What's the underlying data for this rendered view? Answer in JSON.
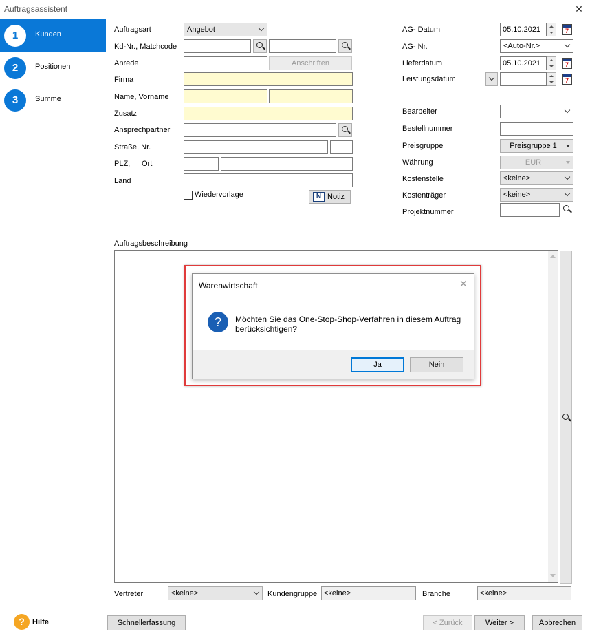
{
  "window": {
    "title": "Auftragsassistent",
    "close_glyph": "✕"
  },
  "sidebar": {
    "steps": [
      {
        "number": "1",
        "label": "Kunden",
        "active": true
      },
      {
        "number": "2",
        "label": "Positionen",
        "active": false
      },
      {
        "number": "3",
        "label": "Summe",
        "active": false
      }
    ]
  },
  "customer": {
    "auftragsart_label": "Auftragsart",
    "auftragsart_value": "Angebot",
    "kdnr_label": "Kd-Nr., Matchcode",
    "anrede_label": "Anrede",
    "anschriften_button": "Anschriften",
    "firma_label": "Firma",
    "name_label": "Name,  Vorname",
    "zusatz_label": "Zusatz",
    "ansprechpartner_label": "Ansprechpartner",
    "strasse_label": "Straße, Nr.",
    "plz_label": "PLZ,",
    "ort_label": "Ort",
    "land_label": "Land",
    "wiedervorlage_label": "Wiedervorlage",
    "notiz_button": "Notiz",
    "notiz_icon_letter": "N"
  },
  "order": {
    "ag_datum_label": "AG- Datum",
    "ag_datum_value": "05.10.2021",
    "ag_nr_label": "AG- Nr.",
    "ag_nr_value": "<Auto-Nr.>",
    "lieferdatum_label": "Lieferdatum",
    "lieferdatum_value": "05.10.2021",
    "leistungsdatum_label": "Leistungsdatum",
    "bearbeiter_label": "Bearbeiter",
    "bestellnummer_label": "Bestellnummer",
    "preisgruppe_label": "Preisgruppe",
    "preisgruppe_value": "Preisgruppe 1",
    "waehrung_label": "Währung",
    "waehrung_value": "EUR",
    "kostenstelle_label": "Kostenstelle",
    "kostenstelle_value": "<keine>",
    "kostentraeger_label": "Kostenträger",
    "kostentraeger_value": "<keine>",
    "projektnummer_label": "Projektnummer"
  },
  "description": {
    "label": "Auftragsbeschreibung"
  },
  "bottom": {
    "vertreter_label": "Vertreter",
    "vertreter_value": "<keine>",
    "kundengruppe_label": "Kundengruppe",
    "kundengruppe_value": "<keine>",
    "branche_label": "Branche",
    "branche_value": "<keine>"
  },
  "footer": {
    "help_label": "Hilfe",
    "help_glyph": "?",
    "schnellerfassung": "Schnellerfassung",
    "zurueck": "< Zurück",
    "weiter": "Weiter >",
    "abbrechen": "Abbrechen"
  },
  "dialog": {
    "title": "Warenwirtschaft",
    "close_glyph": "✕",
    "icon_glyph": "?",
    "message": "Möchten Sie das One-Stop-Shop-Verfahren in diesem Auftrag\nberücksichtigen?",
    "yes": "Ja",
    "no": "Nein"
  },
  "colors": {
    "accent": "#0a78d7",
    "highlight": "#e03b3b",
    "required_field": "#fffbd0",
    "help": "#f5a623"
  }
}
